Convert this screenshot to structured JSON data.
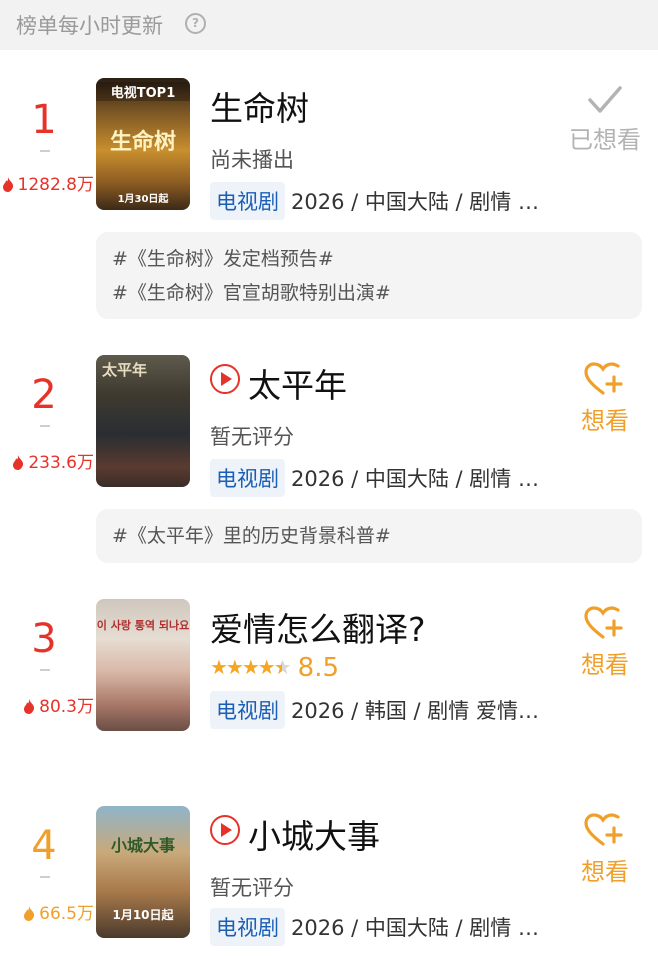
{
  "header": {
    "text": "榜单每小时更新",
    "help_icon": "?"
  },
  "items": [
    {
      "rank": "1",
      "heat": "1282.8万",
      "title": "生命树",
      "has_play": false,
      "subtitle": "尚未播出",
      "tag": "电视剧",
      "meta": "2026 / 中国大陆 / 剧情 …",
      "action": "已想看",
      "action_state": "done",
      "poster": {
        "line1": "电视TOP1",
        "line2": "生命树",
        "line3": "1月30日起"
      },
      "topics": [
        "#《生命树》发定档预告#",
        "#《生命树》官宣胡歌特别出演#"
      ]
    },
    {
      "rank": "2",
      "heat": "233.6万",
      "title": "太平年",
      "has_play": true,
      "subtitle": "暂无评分",
      "tag": "电视剧",
      "meta": "2026 / 中国大陆 / 剧情 …",
      "action": "想看",
      "action_state": "want",
      "poster": {
        "line1": "太平年"
      },
      "topics": [
        "#《太平年》里的历史背景科普#"
      ]
    },
    {
      "rank": "3",
      "heat": "80.3万",
      "title": "爱情怎么翻译?",
      "has_play": false,
      "rating": "8.5",
      "rating_stars": 4.5,
      "tag": "电视剧",
      "meta": "2026 / 韩国 / 剧情 爱情…",
      "action": "想看",
      "action_state": "want",
      "poster": {
        "line1": "이 사랑 통역 되나요"
      }
    },
    {
      "rank": "4",
      "heat": "66.5万",
      "title": "小城大事",
      "has_play": true,
      "subtitle": "暂无评分",
      "tag": "电视剧",
      "meta": "2026 / 中国大陆 / 剧情 …",
      "action": "想看",
      "action_state": "want",
      "poster": {
        "line1": "小城大事",
        "line2": "1月10日起"
      }
    }
  ],
  "colors": {
    "rank_red": "#e6332a",
    "rank_orange": "#f0a02a",
    "tag_blue": "#1b5fb5"
  }
}
